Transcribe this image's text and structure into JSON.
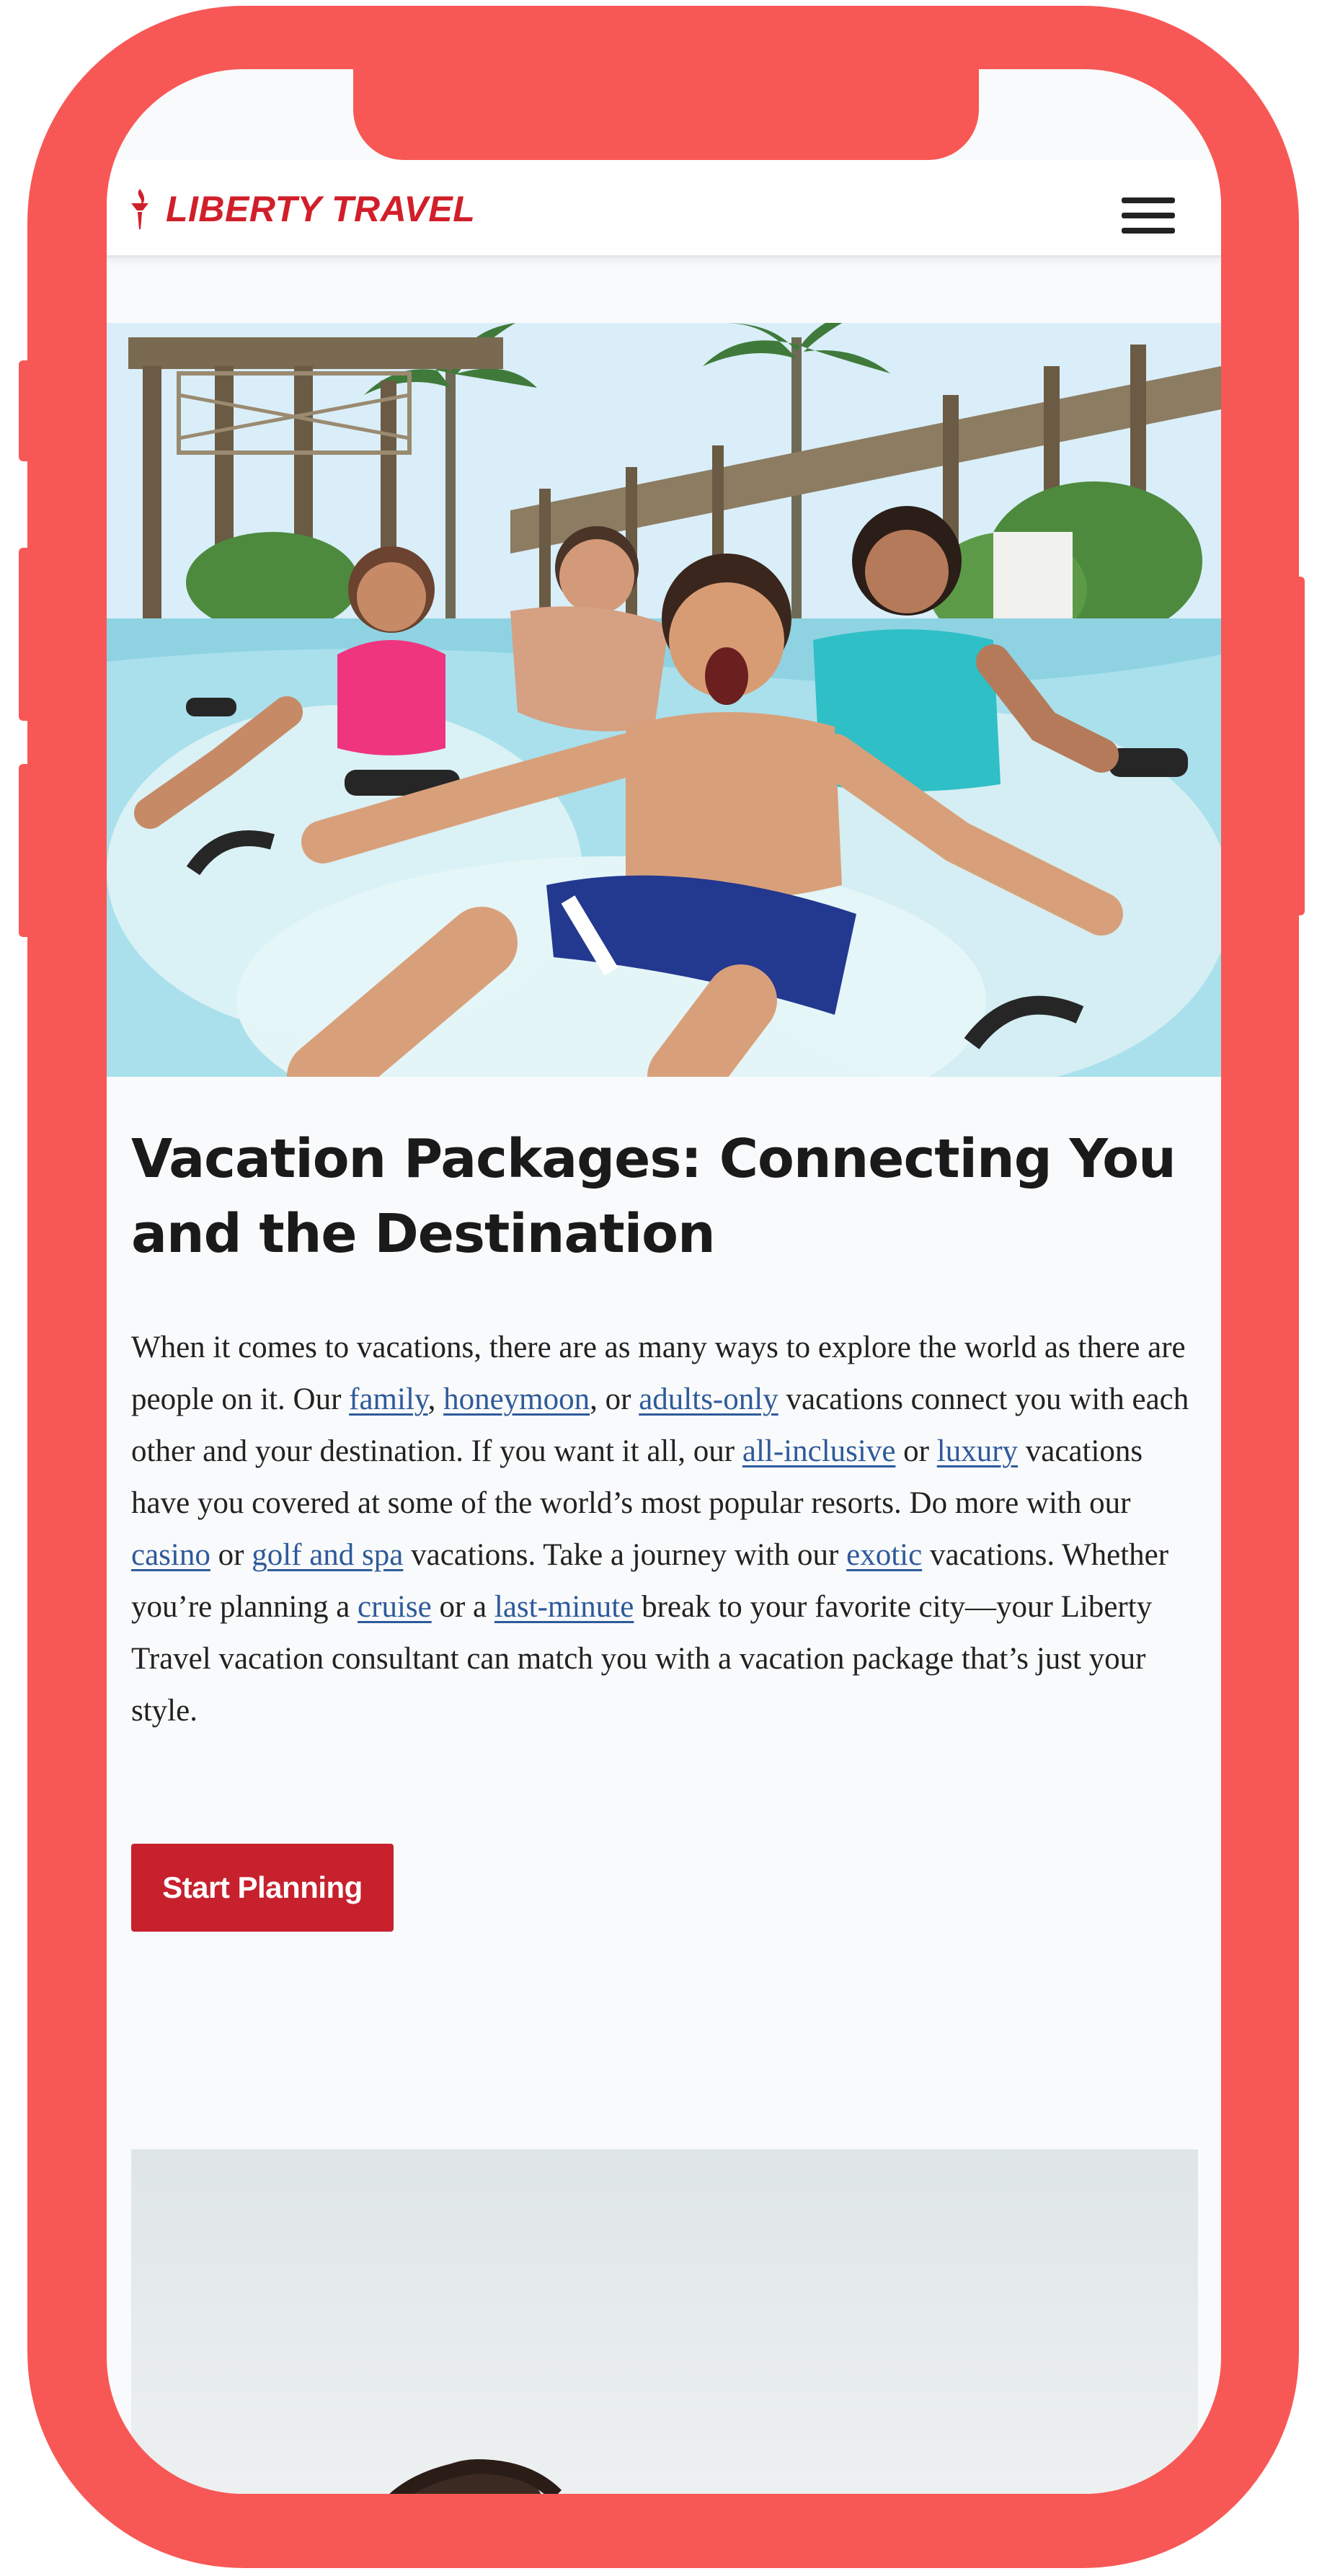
{
  "brand": {
    "name": "LIBERTY TRAVEL",
    "color": "#d11f2a"
  },
  "menu": {
    "icon": "hamburger-menu-icon"
  },
  "hero": {
    "image_subject": "family-water-park-photo"
  },
  "main": {
    "title": "Vacation Packages: Connecting You and the Destination",
    "body": {
      "t1": "When it comes to vacations, there are as many ways to explore the world as there are people on it. Our ",
      "link_family": "family",
      "t2": ", ",
      "link_honeymoon": "honeymoon",
      "t3": ", or ",
      "link_adults_only": "adults-only",
      "t4": " vacations connect you with each other and your destination. If you want it all, our ",
      "link_all_inclusive": "all-inclusive",
      "t5": " or ",
      "link_luxury": "luxury",
      "t6": " vacations have you covered at some of the world’s most popular resorts. Do more with our ",
      "link_casino": "casino",
      "t7": " or ",
      "link_golf_spa": "golf and spa",
      "t8": " vacations. Take a journey with our ",
      "link_exotic": "exotic",
      "t9": " vacations. Whether you’re planning a ",
      "link_cruise": "cruise",
      "t10": " or a ",
      "link_last_minute": "last-minute",
      "t11": " break to your favorite city—your Liberty Travel vacation consultant can match you with a vacation package that’s just your style."
    },
    "cta_label": "Start Planning"
  },
  "colors": {
    "frame": "#f75856",
    "accent": "#c7212e",
    "link": "#2e5a9a",
    "text": "#1a1a1a",
    "page_bg": "#f9fafb"
  }
}
